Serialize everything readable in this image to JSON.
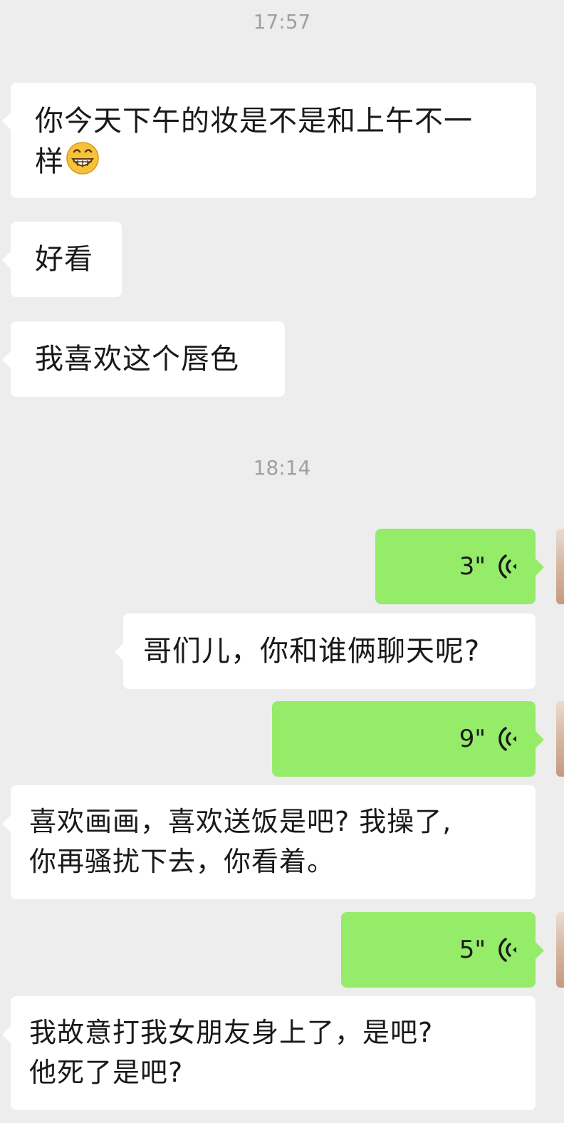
{
  "chat": {
    "timestamps": [
      "17:57",
      "18:14"
    ],
    "messages": [
      {
        "side": "in",
        "type": "text",
        "text_line1": "你今天下午的妆是不是和上午不一",
        "text_line2": "样",
        "emoji": "grinning-face-emoji"
      },
      {
        "side": "in",
        "type": "text",
        "text": "好看"
      },
      {
        "side": "in",
        "type": "text",
        "text": "我喜欢这个唇色"
      },
      {
        "side": "out",
        "type": "voice",
        "duration": "3\"",
        "icon": "voice-wave-icon"
      },
      {
        "side": "in",
        "type": "text",
        "text": "哥们儿，你和谁俩聊天呢?"
      },
      {
        "side": "out",
        "type": "voice",
        "duration": "9\"",
        "icon": "voice-wave-icon"
      },
      {
        "side": "in",
        "type": "text",
        "text_line1": "喜欢画画，喜欢送饭是吧? 我操了,",
        "text_line2": "你再骚扰下去，你看着。"
      },
      {
        "side": "out",
        "type": "voice",
        "duration": "5\"",
        "icon": "voice-wave-icon"
      },
      {
        "side": "in",
        "type": "text",
        "text_line1": "我故意打我女朋友身上了，是吧?",
        "text_line2": "他死了是吧?"
      }
    ]
  },
  "colors": {
    "background": "#ededed",
    "incoming_bubble": "#ffffff",
    "outgoing_bubble": "#95ec69",
    "timestamp_text": "#a0a0a0",
    "message_text": "#191919"
  }
}
